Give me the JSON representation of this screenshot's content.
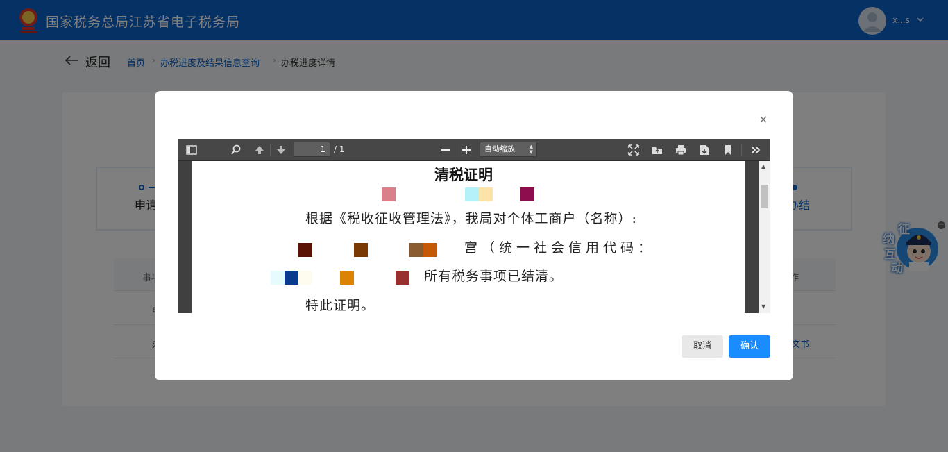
{
  "header": {
    "site_title": "国家税务总局江苏省电子税务局",
    "user_name": "x...s"
  },
  "breadcrumb": {
    "back_label": "返回",
    "items": [
      "首页",
      "办税进度及结果信息查询",
      "办税进度详情"
    ]
  },
  "steps": {
    "first_label": "申请",
    "last_label": "办结"
  },
  "table": {
    "header_first": "事项",
    "header_last": "作",
    "rows": [
      {
        "first": "申",
        "last": ""
      },
      {
        "first": "办",
        "last": "文书"
      }
    ]
  },
  "mascot": {
    "chars": [
      "征",
      "纳",
      "互",
      "动"
    ]
  },
  "modal": {
    "close_glyph": "×",
    "cancel_label": "取消",
    "confirm_label": "确认"
  },
  "pdf_viewer": {
    "current_page": "1",
    "total_pages": "/ 1",
    "zoom_value": "自动缩放",
    "document": {
      "title": "清税证明",
      "line1": "根据《税收征收管理法》，我局对个体工商户（名称）:",
      "line2": "宫（统一社会信用代码：",
      "line3": "所有税务事项已结清。",
      "line4": "特此证明。"
    }
  },
  "colors": {
    "brand_blue": "#0a62c9",
    "confirm_blue": "#1a8cff",
    "redaction_blocks": [
      "#d9808a",
      "#b3f3f7",
      "#fde3a8",
      "#8e0d4e",
      "#5a1405",
      "#7a3a05",
      "#8a5b2f",
      "#c45a05",
      "#e6fbfd",
      "#0a3a8e",
      "#fefcee",
      "#dc8205",
      "#993030"
    ]
  }
}
